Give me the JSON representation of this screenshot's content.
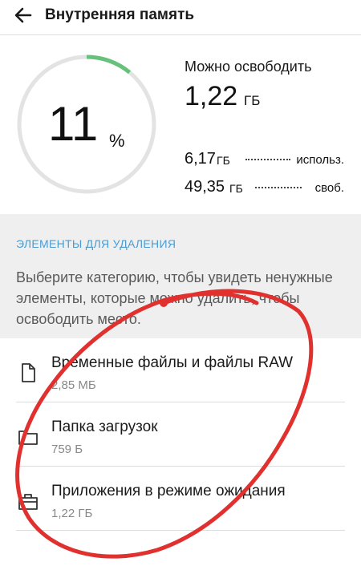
{
  "header": {
    "title": "Внутренняя память",
    "back_icon": "arrow-left-icon"
  },
  "usage": {
    "percent_value": "11",
    "percent_unit": "%",
    "percent": 11,
    "ring_track_color": "#e3e3e3",
    "ring_fill_color": "#66c27a"
  },
  "free": {
    "label": "Можно освободить",
    "value": "1,22",
    "unit": "ГБ"
  },
  "stats": [
    {
      "value": "6,17",
      "unit": "ГБ",
      "label": "использ."
    },
    {
      "value": "49,35",
      "unit": "ГБ",
      "label": "своб."
    }
  ],
  "section": {
    "header": "ЭЛЕМЕНТЫ ДЛЯ УДАЛЕНИЯ",
    "description": "Выберите категорию, чтобы увидеть ненужные элементы, которые можно удалить, чтобы освободить место.",
    "header_color": "#4a9cd2"
  },
  "items": [
    {
      "title": "Временные файлы и файлы RAW",
      "size": "2,85 МБ",
      "icon": "file-icon"
    },
    {
      "title": "Папка загрузок",
      "size": "759 Б",
      "icon": "folder-icon"
    },
    {
      "title": "Приложения в режиме ожидания",
      "size": "1,22 ГБ",
      "icon": "briefcase-icon"
    }
  ],
  "annotation_color": "#e0312f"
}
